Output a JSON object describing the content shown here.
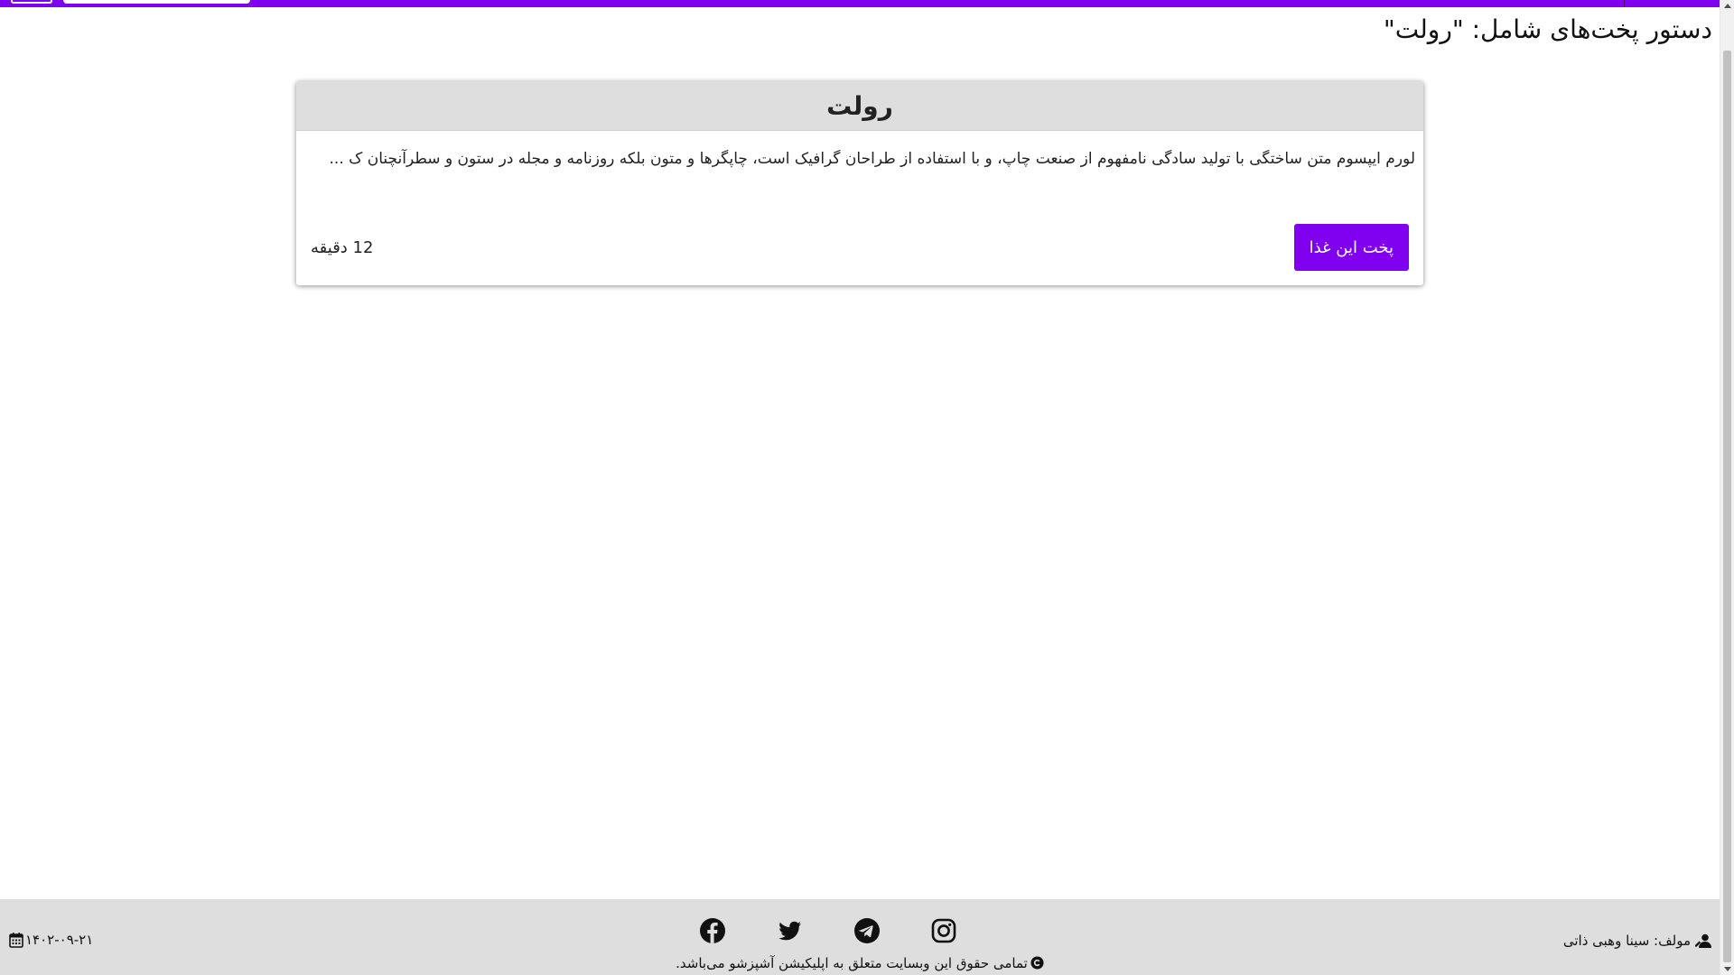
{
  "colors": {
    "accent": "#8000f0",
    "card_header_bg": "#dedede",
    "footer_bg": "#dedede"
  },
  "page": {
    "heading": "دستور پخت‌های شامل: \"رولت\""
  },
  "recipe_card": {
    "title": "رولت",
    "excerpt": "لورم ایپسوم متن ساختگی با تولید سادگی نامفهوم از صنعت چاپ، و با استفاده از طراحان گرافیک است، چاپگرها و متون بلکه روزنامه و مجله در ستون و سطرآنچنان ک ...",
    "cook_button_label": "پخت این غذا",
    "cook_time": "12 دقیقه"
  },
  "footer": {
    "social_icons": [
      "instagram-icon",
      "telegram-icon",
      "twitter-icon",
      "facebook-icon"
    ],
    "copyright_text": "تمامی حقوق این وبسایت متعلق به اپلیکیشن آشپزشو می‌باشد.",
    "author_text": "مولف: سینا وهبی ذاتی",
    "date_text": "۱۴۰۲-۰۹-۲۱"
  }
}
